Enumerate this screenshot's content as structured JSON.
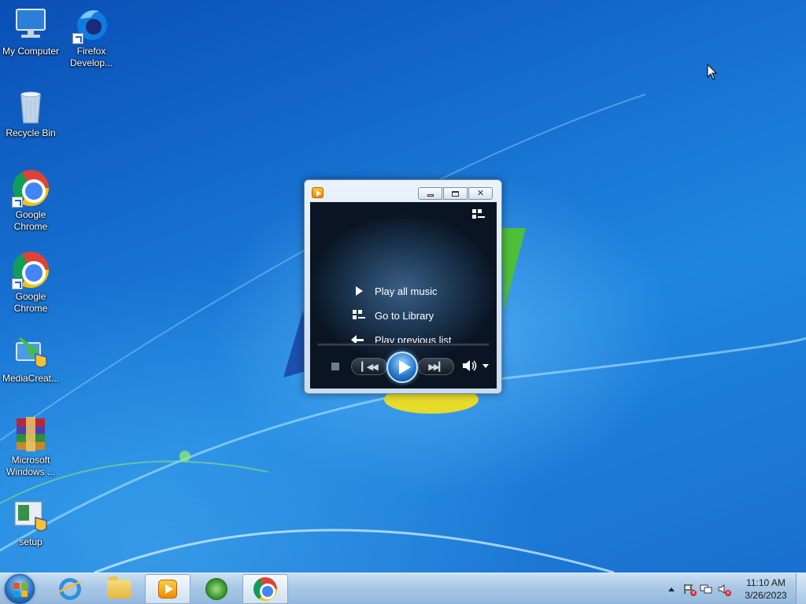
{
  "desktop": {
    "icons": [
      {
        "label": "My Computer",
        "icon": "computer-icon"
      },
      {
        "label": "Firefox Develop...",
        "icon": "firefox-developer-icon"
      },
      {
        "label": "Recycle Bin",
        "icon": "recycle-bin-icon"
      },
      {
        "label": "Google Chrome",
        "icon": "chrome-icon"
      },
      {
        "label": "Google Chrome",
        "icon": "chrome-icon"
      },
      {
        "label": "MediaCreat...",
        "icon": "media-creation-tool-icon"
      },
      {
        "label": "Microsoft Windows ...",
        "icon": "winrar-archive-icon"
      },
      {
        "label": "setup",
        "icon": "setup-icon"
      }
    ]
  },
  "media_player": {
    "menu": [
      {
        "label": "Play all music",
        "icon": "play-icon"
      },
      {
        "label": "Go to Library",
        "icon": "library-icon"
      },
      {
        "label": "Play previous list",
        "icon": "back-arrow-icon"
      }
    ],
    "controls": {
      "stop": "stop-icon",
      "previous": "previous-icon",
      "play": "play-icon",
      "next": "next-icon",
      "volume": "volume-icon"
    }
  },
  "taskbar": {
    "pinned": [
      {
        "name": "internet-explorer",
        "icon": "ie-icon"
      },
      {
        "name": "file-explorer",
        "icon": "folder-icon"
      },
      {
        "name": "windows-media-player",
        "icon": "wmp-icon",
        "active": true
      },
      {
        "name": "windows-media-center",
        "icon": "media-center-icon"
      },
      {
        "name": "google-chrome",
        "icon": "chrome-icon"
      }
    ],
    "clock": {
      "time": "11:10 AM",
      "date": "3/26/2023"
    }
  },
  "colors": {
    "wallpaper": "#1a6fcf",
    "taskbar": "#a9c8e6",
    "wmp_screen": "#0a1422"
  }
}
